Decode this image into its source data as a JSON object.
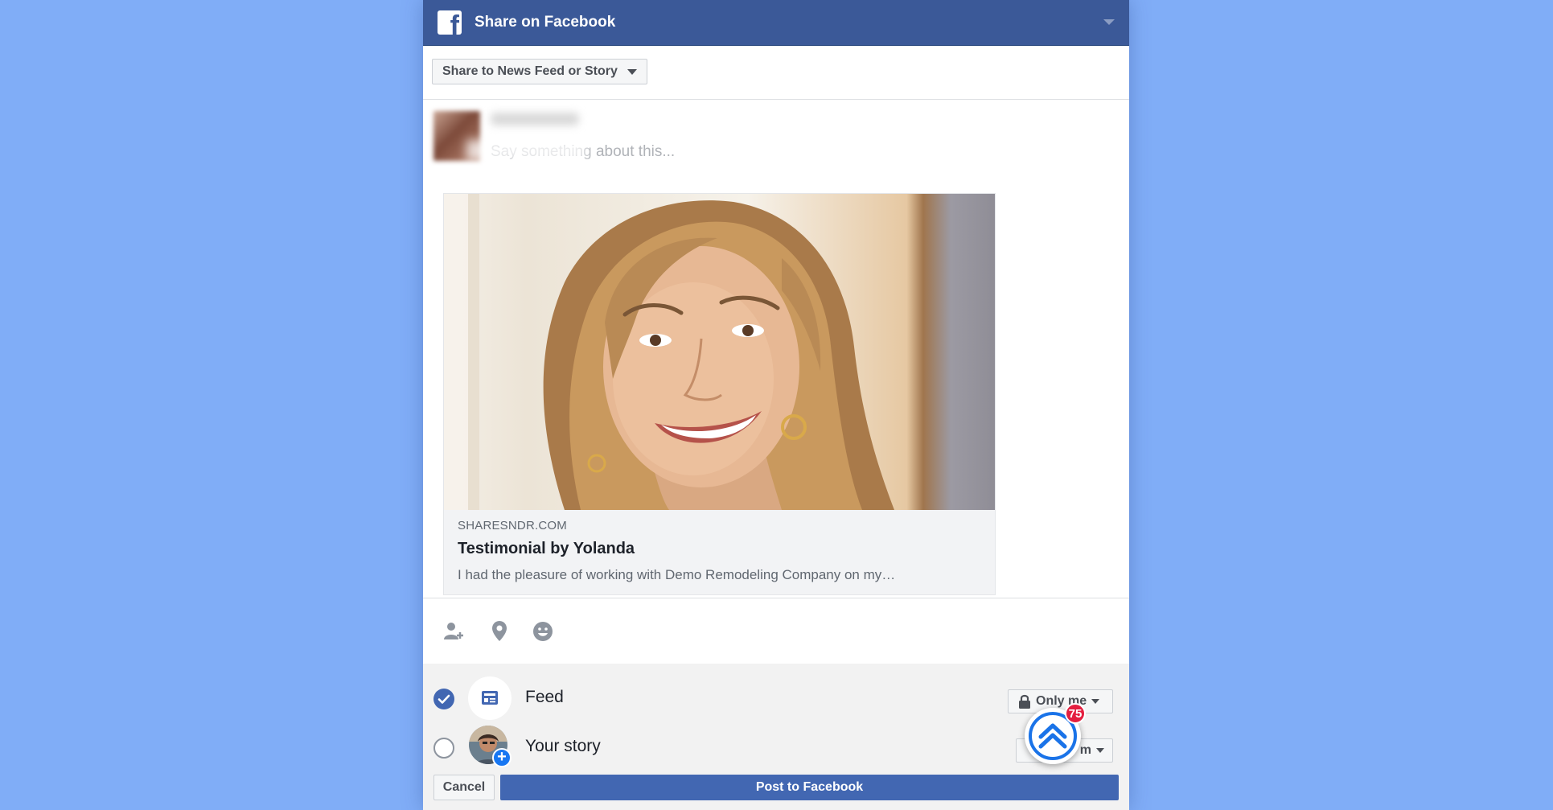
{
  "header": {
    "title": "Share on Facebook"
  },
  "share_selector": {
    "label": "Share to News Feed or Story"
  },
  "composer": {
    "placeholder": "Say something about this..."
  },
  "link_card": {
    "domain": "SHARESNDR.COM",
    "title": "Testimonial by Yolanda",
    "description": "I had the pleasure of working with Demo Remodeling Company on my…"
  },
  "actions": {
    "icons": [
      "tag-friends-icon",
      "location-pin-icon",
      "feeling-emoji-icon"
    ]
  },
  "share_options": {
    "feed": {
      "label": "Feed",
      "checked": true,
      "privacy": "Only me"
    },
    "story": {
      "label": "Your story",
      "checked": false,
      "privacy": "m"
    }
  },
  "footer": {
    "cancel_label": "Cancel",
    "post_label": "Post to Facebook"
  },
  "widget": {
    "badge": "75"
  },
  "colors": {
    "background": "#80adf7",
    "header": "#3b5998",
    "primary_button": "#4267b2",
    "badge": "#e41e3f"
  }
}
